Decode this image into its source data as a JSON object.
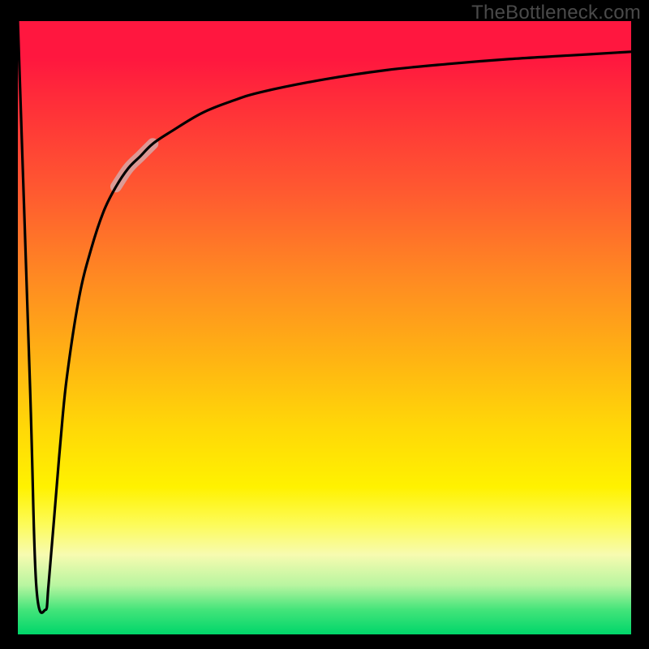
{
  "watermark": "TheBottleneck.com",
  "chart_data": {
    "type": "line",
    "title": "",
    "xlabel": "",
    "ylabel": "",
    "xlim": [
      0,
      100
    ],
    "ylim": [
      0,
      100
    ],
    "grid": false,
    "series": [
      {
        "name": "curve",
        "x": [
          0,
          2,
          3,
          4.5,
          5,
          6,
          7,
          8,
          10,
          12,
          14,
          16,
          18,
          20,
          22,
          25,
          30,
          35,
          40,
          50,
          60,
          70,
          80,
          90,
          100
        ],
        "values": [
          100,
          40,
          8,
          4,
          8,
          20,
          32,
          42,
          55,
          63,
          69,
          73,
          76,
          78,
          80,
          82,
          85,
          87,
          88.5,
          90.5,
          92,
          93,
          93.8,
          94.4,
          95
        ]
      }
    ],
    "highlight": {
      "x_start": 16,
      "x_end": 22
    },
    "background_gradient": {
      "top_color": "#ff173f",
      "bottom_color": "#00d66a"
    }
  }
}
